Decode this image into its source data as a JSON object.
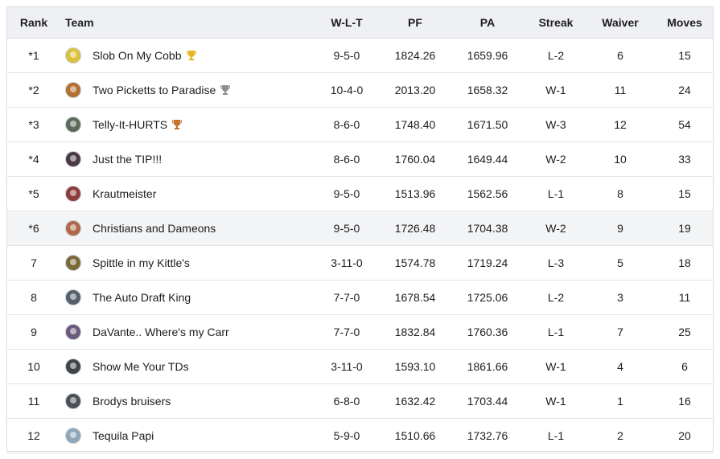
{
  "columns": {
    "rank": "Rank",
    "team": "Team",
    "wlt": "W-L-T",
    "pf": "PF",
    "pa": "PA",
    "streak": "Streak",
    "waiver": "Waiver",
    "moves": "Moves"
  },
  "rows": [
    {
      "rank": "*1",
      "team": "Slob On My Cobb",
      "wlt": "9-5-0",
      "pf": "1824.26",
      "pa": "1659.96",
      "streak": "L-2",
      "waiver": "6",
      "moves": "15",
      "avatar_color": "#d9c23a",
      "trophy": "gold-trophy-icon",
      "trophy_color": "#e3b51e"
    },
    {
      "rank": "*2",
      "team": "Two Picketts to Paradise",
      "wlt": "10-4-0",
      "pf": "2013.20",
      "pa": "1658.32",
      "streak": "W-1",
      "waiver": "11",
      "moves": "24",
      "avatar_color": "#b3702e",
      "trophy": "silver-trophy-icon",
      "trophy_color": "#8a8f96"
    },
    {
      "rank": "*3",
      "team": "Telly-It-HURTS",
      "wlt": "8-6-0",
      "pf": "1748.40",
      "pa": "1671.50",
      "streak": "W-3",
      "waiver": "12",
      "moves": "54",
      "avatar_color": "#5b6b57",
      "trophy": "bronze-trophy-icon",
      "trophy_color": "#c7732b"
    },
    {
      "rank": "*4",
      "team": "Just the TIP!!!",
      "wlt": "8-6-0",
      "pf": "1760.04",
      "pa": "1649.44",
      "streak": "W-2",
      "waiver": "10",
      "moves": "33",
      "avatar_color": "#4a3a44",
      "trophy": "",
      "trophy_color": ""
    },
    {
      "rank": "*5",
      "team": "Krautmeister",
      "wlt": "9-5-0",
      "pf": "1513.96",
      "pa": "1562.56",
      "streak": "L-1",
      "waiver": "8",
      "moves": "15",
      "avatar_color": "#8d3b3b",
      "trophy": "",
      "trophy_color": ""
    },
    {
      "rank": "*6",
      "team": "Christians and Dameons",
      "wlt": "9-5-0",
      "pf": "1726.48",
      "pa": "1704.38",
      "streak": "W-2",
      "waiver": "9",
      "moves": "19",
      "avatar_color": "#b0684a",
      "trophy": "",
      "trophy_color": "",
      "highlight": true
    },
    {
      "rank": "7",
      "team": "Spittle in my Kittle's",
      "wlt": "3-11-0",
      "pf": "1574.78",
      "pa": "1719.24",
      "streak": "L-3",
      "waiver": "5",
      "moves": "18",
      "avatar_color": "#7a6a3a",
      "trophy": "",
      "trophy_color": ""
    },
    {
      "rank": "8",
      "team": "The Auto Draft King",
      "wlt": "7-7-0",
      "pf": "1678.54",
      "pa": "1725.06",
      "streak": "L-2",
      "waiver": "3",
      "moves": "11",
      "avatar_color": "#56616b",
      "trophy": "",
      "trophy_color": ""
    },
    {
      "rank": "9",
      "team": "DaVante.. Where's my Carr",
      "wlt": "7-7-0",
      "pf": "1832.84",
      "pa": "1760.36",
      "streak": "L-1",
      "waiver": "7",
      "moves": "25",
      "avatar_color": "#6b5b7a",
      "trophy": "",
      "trophy_color": ""
    },
    {
      "rank": "10",
      "team": "Show Me Your TDs",
      "wlt": "3-11-0",
      "pf": "1593.10",
      "pa": "1861.66",
      "streak": "W-1",
      "waiver": "4",
      "moves": "6",
      "avatar_color": "#3f4448",
      "trophy": "",
      "trophy_color": ""
    },
    {
      "rank": "11",
      "team": "Brodys bruisers",
      "wlt": "6-8-0",
      "pf": "1632.42",
      "pa": "1703.44",
      "streak": "W-1",
      "waiver": "1",
      "moves": "16",
      "avatar_color": "#4b5157",
      "trophy": "",
      "trophy_color": ""
    },
    {
      "rank": "12",
      "team": "Tequila Papi",
      "wlt": "5-9-0",
      "pf": "1510.66",
      "pa": "1732.76",
      "streak": "L-1",
      "waiver": "2",
      "moves": "20",
      "avatar_color": "#8fa7b8",
      "trophy": "",
      "trophy_color": ""
    }
  ]
}
